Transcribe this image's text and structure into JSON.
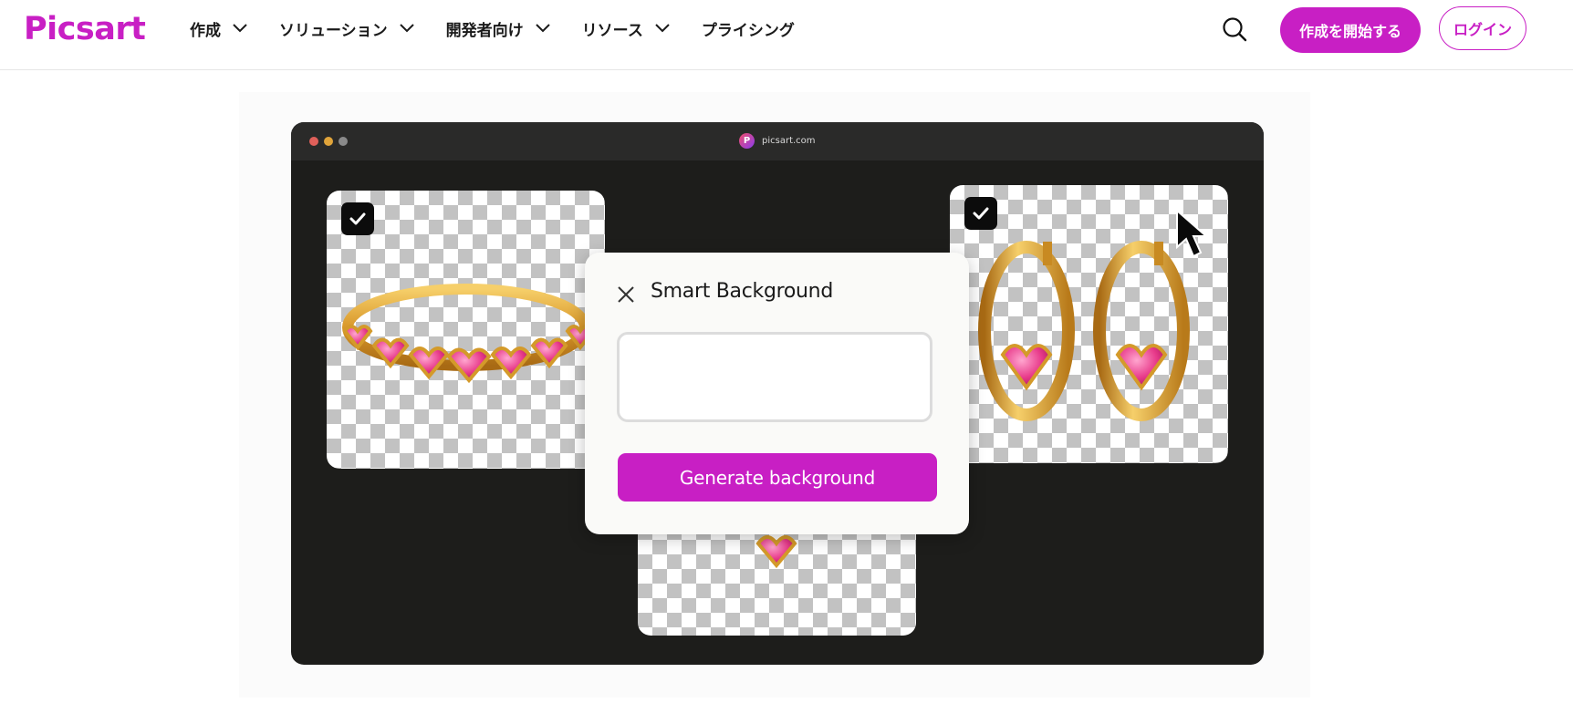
{
  "brand": {
    "logo_text": "Picsart",
    "accent_color": "#c81fc4"
  },
  "nav": {
    "items": [
      {
        "label": "作成",
        "has_dropdown": true
      },
      {
        "label": "ソリューション",
        "has_dropdown": true
      },
      {
        "label": "開発者向け",
        "has_dropdown": true
      },
      {
        "label": "リソース",
        "has_dropdown": true
      },
      {
        "label": "プライシング",
        "has_dropdown": false
      }
    ]
  },
  "header_actions": {
    "search_icon": "search-icon",
    "start_label": "作成を開始する",
    "login_label": "ログイン"
  },
  "browser_mock": {
    "url": "picsart.com",
    "favicon_letter": "P",
    "traffic_light_colors": [
      "#e0605a",
      "#e0a43a",
      "#8a8a8a"
    ]
  },
  "cards": [
    {
      "name": "ring",
      "checked": true
    },
    {
      "name": "earrings",
      "checked": true
    },
    {
      "name": "necklace",
      "checked": false
    }
  ],
  "dialog": {
    "title": "Smart Background",
    "input_value": "",
    "generate_label": "Generate background"
  }
}
